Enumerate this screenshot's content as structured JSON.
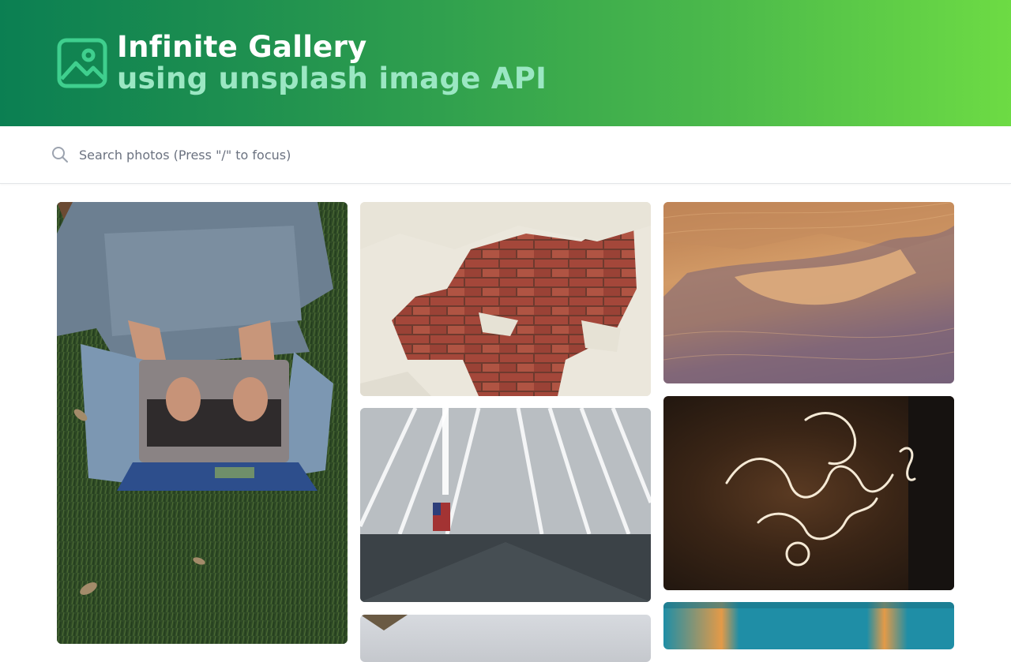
{
  "header": {
    "title": "Infinite Gallery",
    "subtitle": "using unsplash image API",
    "logo_icon": "image-icon",
    "gradient": [
      "#0b7f52",
      "#6ddb44"
    ]
  },
  "search": {
    "placeholder": "Search photos (Press \"/\" to focus)",
    "value": "",
    "icon": "search-icon"
  },
  "gallery": {
    "photos": [
      {
        "subject": "laptop-on-grass"
      },
      {
        "subject": "brick-wall"
      },
      {
        "subject": "desert-dunes"
      },
      {
        "subject": "oculus-architecture"
      },
      {
        "subject": "neon-sign"
      },
      {
        "subject": "partial-light"
      },
      {
        "subject": "partial-striped"
      }
    ]
  }
}
